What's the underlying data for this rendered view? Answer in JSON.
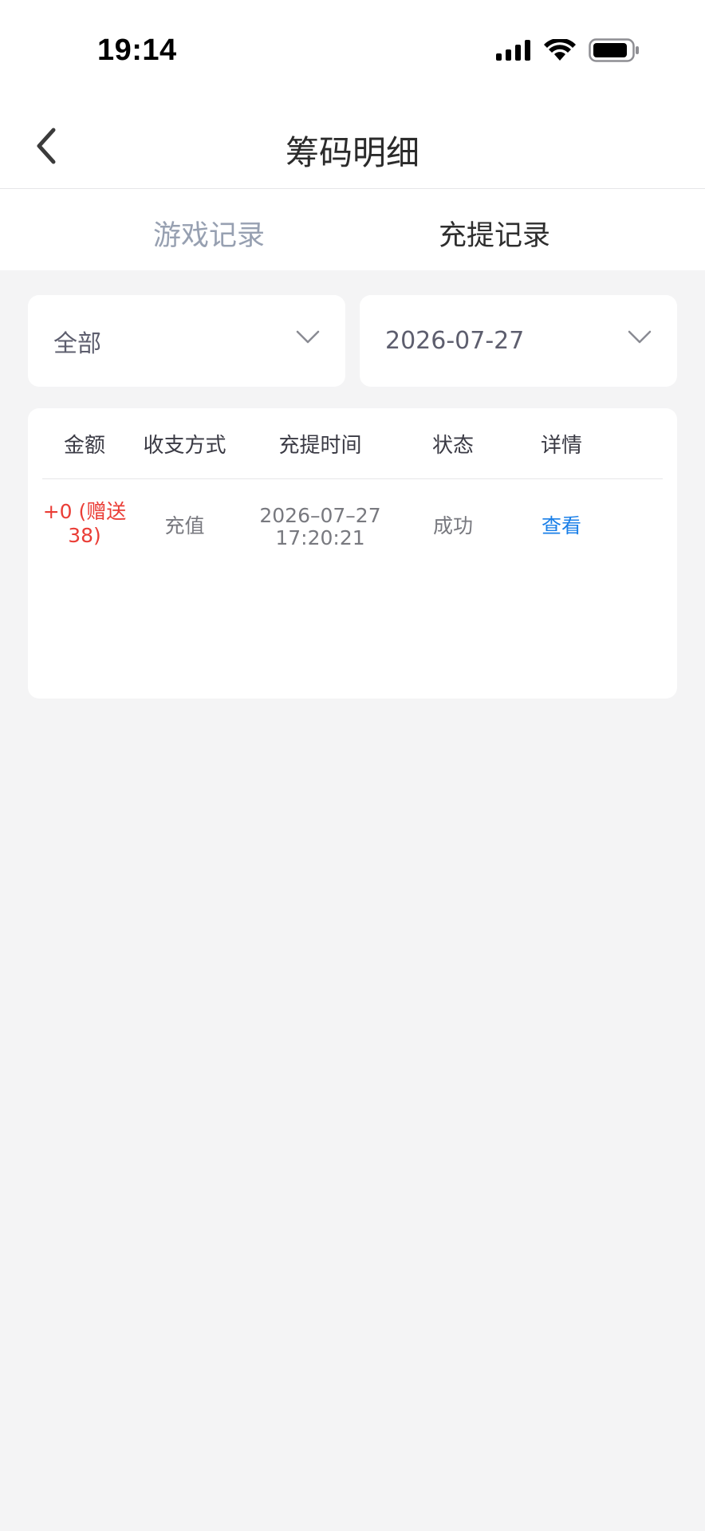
{
  "status_bar": {
    "time": "19:14"
  },
  "nav": {
    "title": "筹码明细"
  },
  "tabs": [
    {
      "label": "游戏记录",
      "active": false
    },
    {
      "label": "充提记录",
      "active": true
    }
  ],
  "filters": {
    "type": {
      "value": "全部"
    },
    "date": {
      "value": "2026-07-27"
    }
  },
  "table": {
    "headers": [
      "金额",
      "收支方式",
      "充提时间",
      "状态",
      "详情"
    ],
    "rows": [
      {
        "amount_line1": "+0 (赠送",
        "amount_line2": "38)",
        "method": "充值",
        "date": "2026–07–27",
        "time": "17:20:21",
        "status": "成功",
        "detail": "查看"
      }
    ]
  },
  "colors": {
    "amount": "#ea3d36",
    "link": "#1a7fe8",
    "tab_active": "#2e2e2e",
    "tab_inactive": "#97a0b1",
    "page_bg": "#f4f4f5"
  },
  "icons": [
    "signal-icon",
    "wifi-icon",
    "battery-icon",
    "back-arrow-icon",
    "chevron-down-icon"
  ]
}
